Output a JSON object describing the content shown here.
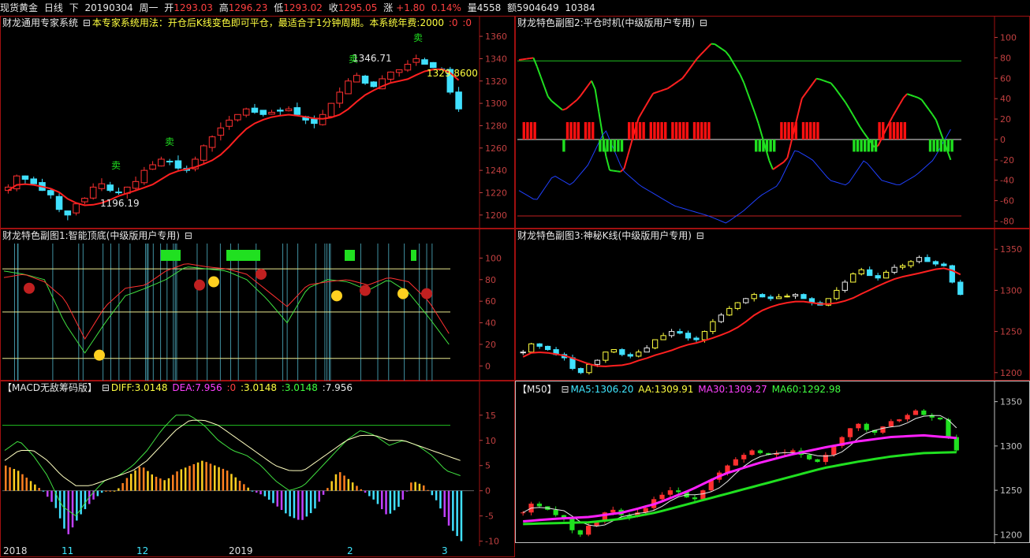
{
  "header": {
    "symbol": "现货黄金",
    "period": "日线",
    "mode": "下",
    "date": "20190304",
    "weekday": "周一",
    "open_label": "开",
    "open": "1293.03",
    "high_label": "高",
    "high": "1296.23",
    "low_label": "低",
    "low": "1293.02",
    "close_label": "收",
    "close": "1295.05",
    "chg_label": "涨",
    "chg": "+1.80",
    "pct": "0.14%",
    "vol_label": "量",
    "vol": "4558",
    "amt_label": "额",
    "amt": "5904649",
    "extra": "10384"
  },
  "panels": {
    "main": {
      "title": "财龙通用专家系统",
      "desc": "本专家系统用法：开仓后K线变色即可平仓，最适合于1分钟周期。本系统年费:2000",
      "v1": ":0",
      "v2": ":0",
      "ann_high": "1346.71",
      "ann_low": "1196.19",
      "ann_last": "1329.8600",
      "sell": "卖",
      "yticks": [
        "1360",
        "1340",
        "1320",
        "1300",
        "1280",
        "1260",
        "1240",
        "1220",
        "1200"
      ]
    },
    "sub2": {
      "title": "财龙特色副图2:平仓时机(中级版用户专用)",
      "yticks": [
        "100",
        "80",
        "60",
        "40",
        "20",
        "0",
        "-20",
        "-40",
        "-60",
        "-80"
      ]
    },
    "sub1": {
      "title": "财龙特色副图1:智能顶底(中级版用户专用)",
      "yticks": [
        "100",
        "80",
        "60",
        "40",
        "20",
        "0"
      ]
    },
    "sub3": {
      "title": "财龙特色副图3:神秘K线(中级版用户专用)",
      "yticks": [
        "1350",
        "1300",
        "1250",
        "1200"
      ]
    },
    "macd": {
      "title": "【MACD无敌筹码版】",
      "diff": "DIFF:3.0148",
      "dea": "DEA:7.956",
      "v0": ":0",
      "v1": ":3.0148",
      "v2": ":3.0148",
      "v3": ":7.956",
      "yticks": [
        "15",
        "10",
        "5",
        "0",
        "-5",
        "-10"
      ]
    },
    "ma": {
      "title": "【M50】",
      "ma5": "MA5:1306.20",
      "aa": "AA:1309.91",
      "ma30": "MA30:1309.27",
      "ma60": "MA60:1292.98",
      "yticks": [
        "1350",
        "1300",
        "1250",
        "1200"
      ]
    }
  },
  "xaxis": [
    "2018",
    "11",
    "12",
    "2019",
    "2",
    "3"
  ],
  "colors": {
    "up": "#ff3030",
    "down": "#40e0ff",
    "frame": "#a01010",
    "green": "#20e020",
    "yellow": "#ffff40"
  },
  "chart_data": [
    {
      "type": "candlestick",
      "title": "财龙通用专家系统",
      "ylim": [
        1190,
        1365
      ],
      "close_approx": [
        1225,
        1235,
        1232,
        1228,
        1222,
        1218,
        1205,
        1200,
        1210,
        1215,
        1225,
        1228,
        1222,
        1220,
        1225,
        1230,
        1240,
        1245,
        1250,
        1248,
        1242,
        1240,
        1250,
        1262,
        1270,
        1278,
        1285,
        1290,
        1295,
        1292,
        1290,
        1292,
        1293,
        1295,
        1290,
        1285,
        1282,
        1290,
        1300,
        1310,
        1320,
        1325,
        1318,
        1315,
        1322,
        1328,
        1330,
        1335,
        1340,
        1335,
        1332,
        1330,
        1310,
        1295
      ],
      "annotations": [
        "1346.71",
        "1196.19",
        "1329.8600"
      ]
    },
    {
      "type": "line",
      "title": "财龙特色副图2:平仓时机(中级版用户专用)",
      "ylim": [
        -85,
        105
      ]
    },
    {
      "type": "line",
      "title": "财龙特色副图1:智能顶底(中级版用户专用)",
      "ylim": [
        -10,
        115
      ]
    },
    {
      "type": "candlestick",
      "title": "财龙特色副图3:神秘K线(中级版用户专用)",
      "ylim": [
        1195,
        1355
      ]
    },
    {
      "type": "bar",
      "title": "【MACD无敌筹码版】",
      "ylim": [
        -11,
        17
      ],
      "series": [
        {
          "name": "DIFF",
          "last": 3.0148
        },
        {
          "name": "DEA",
          "last": 7.956
        }
      ]
    },
    {
      "type": "line",
      "title": "【M50】",
      "ylim": [
        1195,
        1355
      ],
      "series": [
        {
          "name": "MA5",
          "last": 1306.2
        },
        {
          "name": "AA",
          "last": 1309.91
        },
        {
          "name": "MA30",
          "last": 1309.27
        },
        {
          "name": "MA60",
          "last": 1292.98
        }
      ]
    }
  ]
}
